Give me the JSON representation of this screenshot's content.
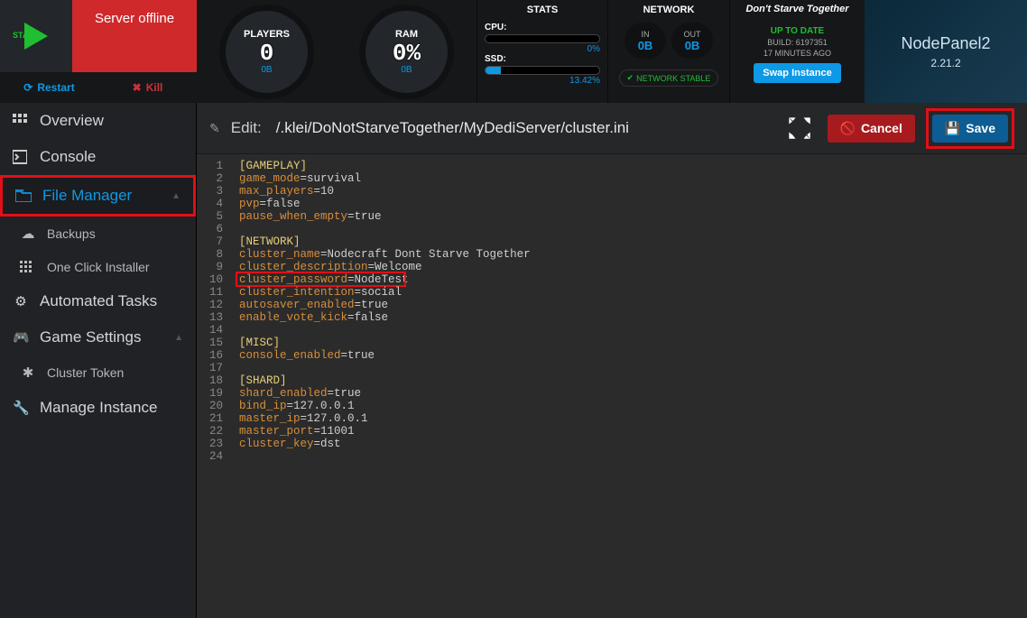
{
  "header": {
    "start_label": "START",
    "server_status": "Server offline",
    "restart_label": "Restart",
    "kill_label": "Kill"
  },
  "gauges": {
    "players": {
      "label": "PLAYERS",
      "value": "0",
      "sub": "0B"
    },
    "ram": {
      "label": "RAM",
      "value": "0%",
      "sub": "0B"
    }
  },
  "stats": {
    "title": "STATS",
    "cpu_label": "CPU:",
    "cpu_value": "0%",
    "cpu_pct": 0,
    "ssd_label": "SSD:",
    "ssd_value": "13.42%",
    "ssd_pct": 13.42
  },
  "network": {
    "title": "NETWORK",
    "in_label": "IN",
    "in_value": "0B",
    "out_label": "OUT",
    "out_value": "0B",
    "stable": "NETWORK STABLE"
  },
  "game": {
    "title": "Don't Starve Together",
    "uptodate": "UP TO DATE",
    "build": "BUILD: 6197351",
    "time": "17 MINUTES AGO",
    "swap": "Swap Instance"
  },
  "brand": {
    "title": "NodePanel2",
    "version": "2.21.2"
  },
  "sidebar": {
    "overview": "Overview",
    "console": "Console",
    "file_manager": "File Manager",
    "backups": "Backups",
    "one_click": "One Click Installer",
    "automated": "Automated Tasks",
    "game_settings": "Game Settings",
    "cluster_token": "Cluster Token",
    "manage_instance": "Manage Instance"
  },
  "editor": {
    "edit_label": "Edit:",
    "path": "/.klei/DoNotStarveTogether/MyDediServer/cluster.ini",
    "cancel": "Cancel",
    "save": "Save",
    "lines": [
      {
        "n": 1,
        "type": "section",
        "text": "[GAMEPLAY]"
      },
      {
        "n": 2,
        "type": "kv",
        "key": "game_mode",
        "val": "survival"
      },
      {
        "n": 3,
        "type": "kv",
        "key": "max_players",
        "val": "10"
      },
      {
        "n": 4,
        "type": "kv",
        "key": "pvp",
        "val": "false"
      },
      {
        "n": 5,
        "type": "kv",
        "key": "pause_when_empty",
        "val": "true"
      },
      {
        "n": 6,
        "type": "blank"
      },
      {
        "n": 7,
        "type": "section",
        "text": "[NETWORK]"
      },
      {
        "n": 8,
        "type": "kv",
        "key": "cluster_name",
        "val": "Nodecraft Dont Starve Together"
      },
      {
        "n": 9,
        "type": "kv",
        "key": "cluster_description",
        "val": "Welcome"
      },
      {
        "n": 10,
        "type": "kv",
        "key": "cluster_password",
        "val": "NodeTest",
        "highlight": true
      },
      {
        "n": 11,
        "type": "kv",
        "key": "cluster_intention",
        "val": "social"
      },
      {
        "n": 12,
        "type": "kv",
        "key": "autosaver_enabled",
        "val": "true"
      },
      {
        "n": 13,
        "type": "kv",
        "key": "enable_vote_kick",
        "val": "false"
      },
      {
        "n": 14,
        "type": "blank"
      },
      {
        "n": 15,
        "type": "section",
        "text": "[MISC]"
      },
      {
        "n": 16,
        "type": "kv",
        "key": "console_enabled",
        "val": "true"
      },
      {
        "n": 17,
        "type": "blank"
      },
      {
        "n": 18,
        "type": "section",
        "text": "[SHARD]"
      },
      {
        "n": 19,
        "type": "kv",
        "key": "shard_enabled",
        "val": "true"
      },
      {
        "n": 20,
        "type": "kv",
        "key": "bind_ip",
        "val": "127.0.0.1"
      },
      {
        "n": 21,
        "type": "kv",
        "key": "master_ip",
        "val": "127.0.0.1"
      },
      {
        "n": 22,
        "type": "kv",
        "key": "master_port",
        "val": "11001"
      },
      {
        "n": 23,
        "type": "kv",
        "key": "cluster_key",
        "val": "dst"
      },
      {
        "n": 24,
        "type": "blank"
      }
    ]
  }
}
